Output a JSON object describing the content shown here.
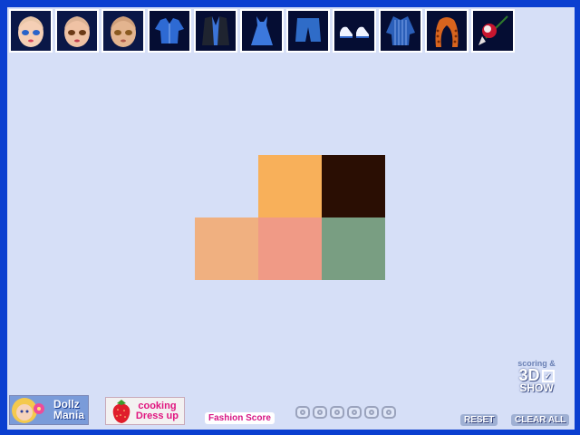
{
  "toolbar": {
    "items": [
      {
        "name": "face-1",
        "icon": "doll-face-icon"
      },
      {
        "name": "face-2",
        "icon": "doll-face-icon"
      },
      {
        "name": "face-3",
        "icon": "doll-face-icon"
      },
      {
        "name": "blouse",
        "icon": "blue-blouse-icon"
      },
      {
        "name": "jacket",
        "icon": "black-jacket-icon"
      },
      {
        "name": "dress",
        "icon": "blue-dress-icon"
      },
      {
        "name": "shorts",
        "icon": "denim-shorts-icon"
      },
      {
        "name": "sneakers",
        "icon": "sneakers-icon"
      },
      {
        "name": "shirt",
        "icon": "striped-shirt-icon"
      },
      {
        "name": "hair",
        "icon": "braided-hair-icon"
      },
      {
        "name": "accessory",
        "icon": "flower-accessory-icon"
      }
    ]
  },
  "palette": {
    "colors": [
      "#f8b05a",
      "#2a0e03",
      "#f0b080",
      "#f09a86",
      "#799e82"
    ]
  },
  "bottom": {
    "dollz_label_1": "Dollz",
    "dollz_label_2": "Mania",
    "cooking_label_1": "cooking",
    "cooking_label_2": "Dress up",
    "fashion_score_label": "Fashion Score",
    "score_dots": 6,
    "reset_label": "RESET",
    "clear_all_label": "CLEAR ALL",
    "show_line1": "scoring &",
    "show_line2": "3D",
    "show_line3": "SHOW"
  }
}
